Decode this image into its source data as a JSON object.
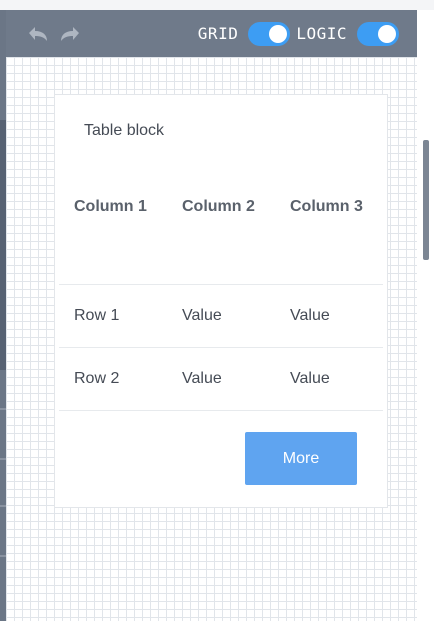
{
  "toolbar": {
    "undo_icon": "undo-arrow-icon",
    "redo_icon": "redo-arrow-icon",
    "grid_label": "GRID",
    "grid_on": true,
    "logic_label": "LOGIC",
    "logic_on": true,
    "accent_color": "#3d9df3",
    "bar_color": "#6f7a8a"
  },
  "card": {
    "title": "Table block",
    "columns": [
      "Column 1",
      "Column 2",
      "Column 3"
    ],
    "rows": [
      [
        "Row 1",
        "Value",
        "Value"
      ],
      [
        "Row 2",
        "Value",
        "Value"
      ]
    ],
    "more_label": "More",
    "button_color": "#5fa4f0"
  }
}
